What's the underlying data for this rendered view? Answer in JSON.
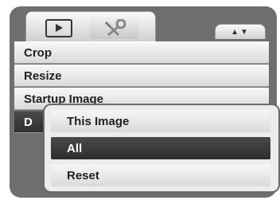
{
  "tabs": [
    {
      "id": "playback",
      "icon": "playback-icon"
    },
    {
      "id": "setup",
      "icon": "wrench-icon"
    }
  ],
  "scroll_indicator": "▲▼",
  "menu": {
    "items": [
      {
        "label": "Crop"
      },
      {
        "label": "Resize"
      },
      {
        "label": "Startup Image"
      },
      {
        "label": "D"
      }
    ],
    "selected_index": 3
  },
  "submenu": {
    "items": [
      {
        "label": "This Image"
      },
      {
        "label": "All"
      },
      {
        "label": "Reset"
      }
    ],
    "selected_index": 1
  },
  "colors": {
    "selected_bg": "#3a3a3a",
    "item_bg": "#e6e6e6",
    "screen_bg": "#6e6e6e"
  }
}
